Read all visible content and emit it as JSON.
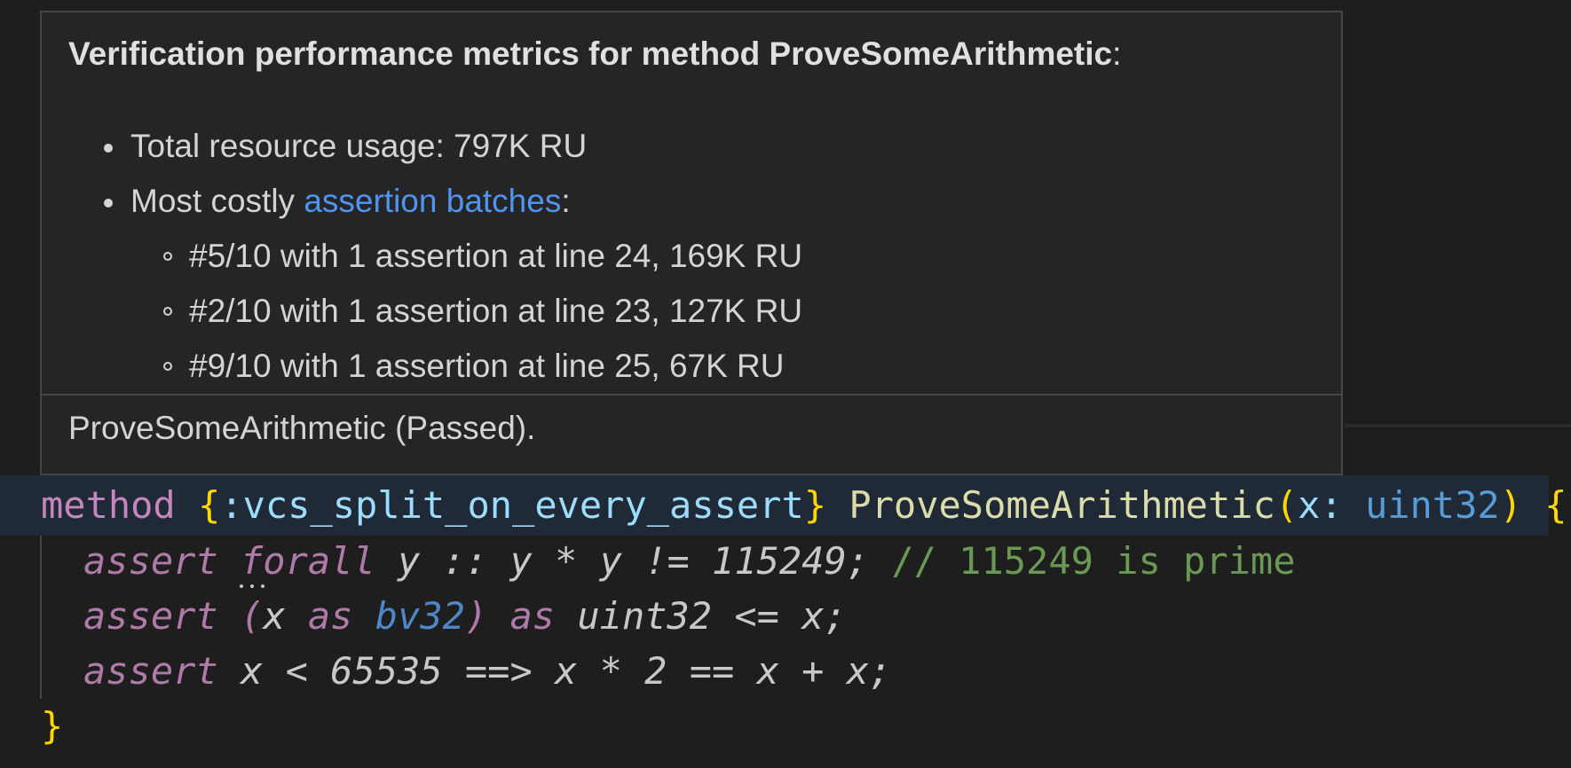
{
  "hover": {
    "title": "Verification performance metrics for method ProveSomeArithmetic",
    "title_suffix": ":",
    "total_usage": "Total resource usage: 797K RU",
    "costly_prefix": "Most costly ",
    "costly_link": "assertion batches",
    "costly_suffix": ":",
    "batches": [
      "#5/10 with 1 assertion at line 24, 169K RU",
      "#2/10 with 1 assertion at line 23, 127K RU",
      "#9/10 with 1 assertion at line 25, 67K RU"
    ],
    "status": "ProveSomeArithmetic (Passed)."
  },
  "code": {
    "line1": {
      "kw_method": "method",
      "space1": " ",
      "brace_open": "{",
      "attribute": ":vcs_split_on_every_assert",
      "brace_close": "}",
      "space2": " ",
      "name": "ProveSomeArithmetic",
      "paren_open": "(",
      "param": "x: ",
      "param_type": "uint32",
      "paren_close": ")",
      "space3": " ",
      "body_open": "{"
    },
    "line2": {
      "kw_assert": "assert",
      "space": " ",
      "kw_forall": "forall",
      "expr": " y :: y * y != 115249; ",
      "comment": "// 115249 is prime"
    },
    "line3": {
      "kw_assert": "assert",
      "space": " ",
      "paren_open": "(",
      "var": "x ",
      "kw_as": "as",
      "space2": " ",
      "type_bv": "bv32",
      "paren_close": ")",
      "space3": " ",
      "kw_as2": "as",
      "rest": " uint32 <= x;"
    },
    "line4": {
      "kw_assert": "assert",
      "expr": " x < 65535 ==> x * 2 == x + x;"
    },
    "line5": {
      "body_close": "}"
    }
  },
  "colors": {
    "background": "#1e1e1e",
    "hover_background": "#252526",
    "link": "#4e94f0",
    "keyword": "#c586c0",
    "function": "#dcdcaa",
    "type": "#569cd6",
    "comment": "#6a9955",
    "brace": "#ffd700"
  }
}
